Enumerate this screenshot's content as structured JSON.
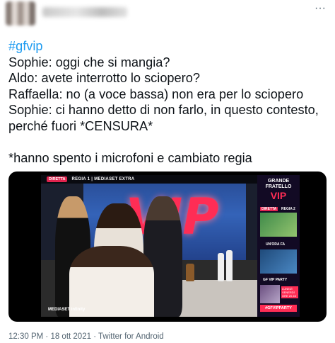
{
  "tweet": {
    "more_icon": "more-horizontal-icon",
    "hashtag": "#gfvip",
    "lines": [
      "Sophie: oggi che si mangia?",
      "Aldo: avete interrotto lo sciopero?",
      "Raffaella: no (a voce bassa) non era per lo sciopero",
      "Sophie: ci hanno detto di non farlo, in questo contesto, perché fuori *CENSURA*",
      "",
      "*hanno spento i microfoni e cambiato regia"
    ],
    "timestamp": "12:30 PM · 18 ott 2021 · Twitter for Android"
  },
  "media": {
    "live_badge": "DIRETTA",
    "channel": "REGIA 1 | MEDIASET EXTRA",
    "vip_sign": "VIP",
    "mediaset_logo": "MEDIASET infinity",
    "show_logo_top": "GRANDE FRATELLO",
    "show_logo_vip": "VIP",
    "panel_live": "DIRETTA",
    "panel_regia": "REGIA 2",
    "panel_un_ora": "UN'ORA FA",
    "panel_gf_party": "GF VIP PARTY",
    "panel_schedule": "LUNEDÌ VENERDÌ ORE 20.45",
    "panel_hashtag": "#GFVIPPARTY"
  }
}
